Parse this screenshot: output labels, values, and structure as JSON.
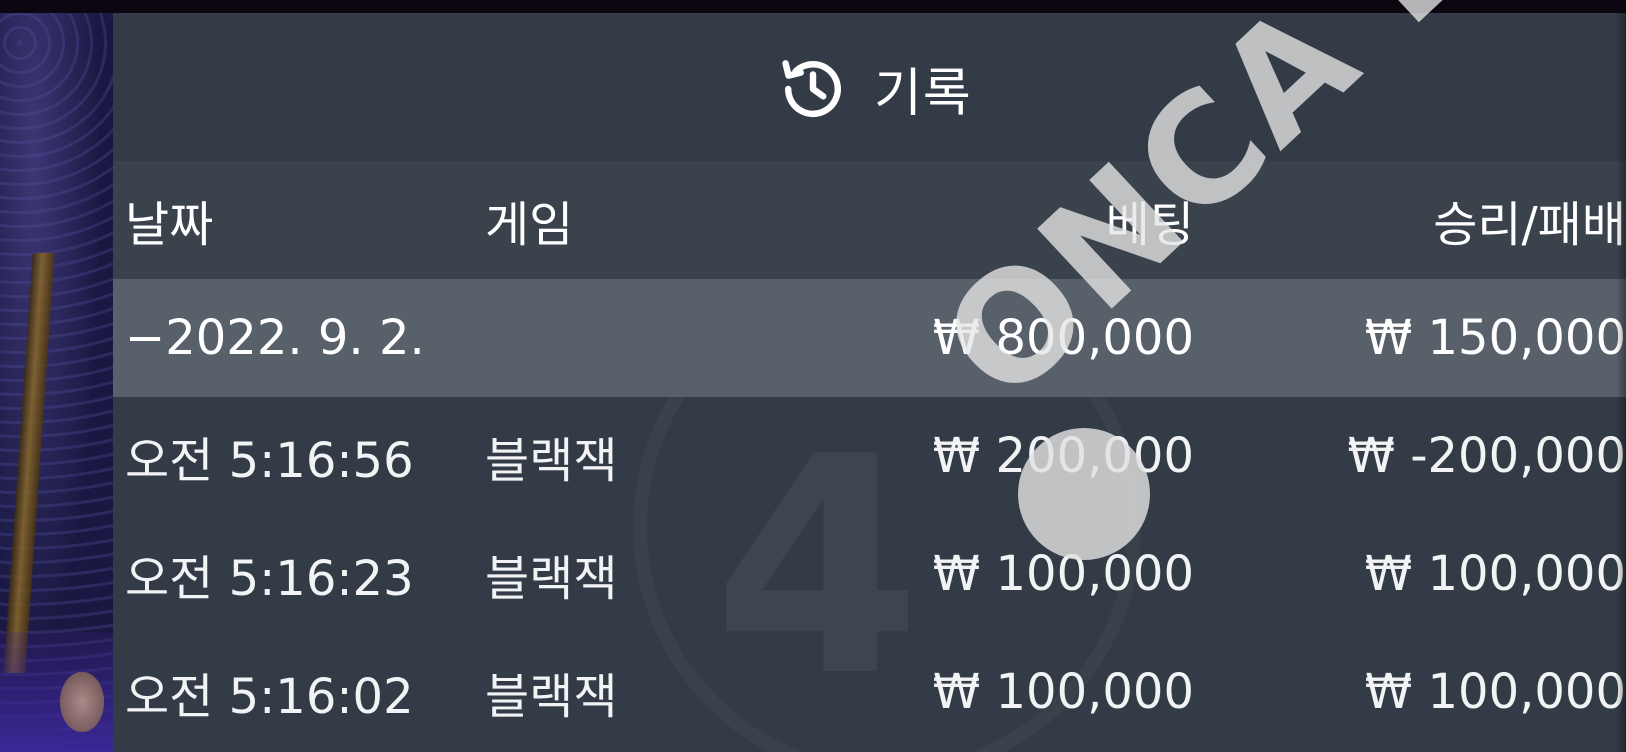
{
  "panel": {
    "title": "기록",
    "icon": "history-icon"
  },
  "table": {
    "columns": {
      "date": "날짜",
      "game": "게임",
      "bet": "베팅",
      "result": "승리/패배"
    },
    "summary": {
      "date": "−2022. 9. 2.",
      "game": "",
      "bet": "₩ 800,000",
      "result": "₩ 150,000"
    },
    "rows": [
      {
        "time": "오전 5:16:56",
        "game": "블랙잭",
        "bet": "₩ 200,000",
        "result": "₩ -200,000"
      },
      {
        "time": "오전 5:16:23",
        "game": "블랙잭",
        "bet": "₩ 100,000",
        "result": "₩ 100,000"
      },
      {
        "time": "오전 5:16:02",
        "game": "블랙잭",
        "bet": "₩ 100,000",
        "result": "₩ 100,000"
      }
    ]
  },
  "watermark": {
    "text": "ONCA BEST"
  },
  "colors": {
    "panel_bg": "#333b46",
    "header_row_bg": "#3a424c",
    "summary_row_bg": "#58606a",
    "text": "#ffffff"
  }
}
